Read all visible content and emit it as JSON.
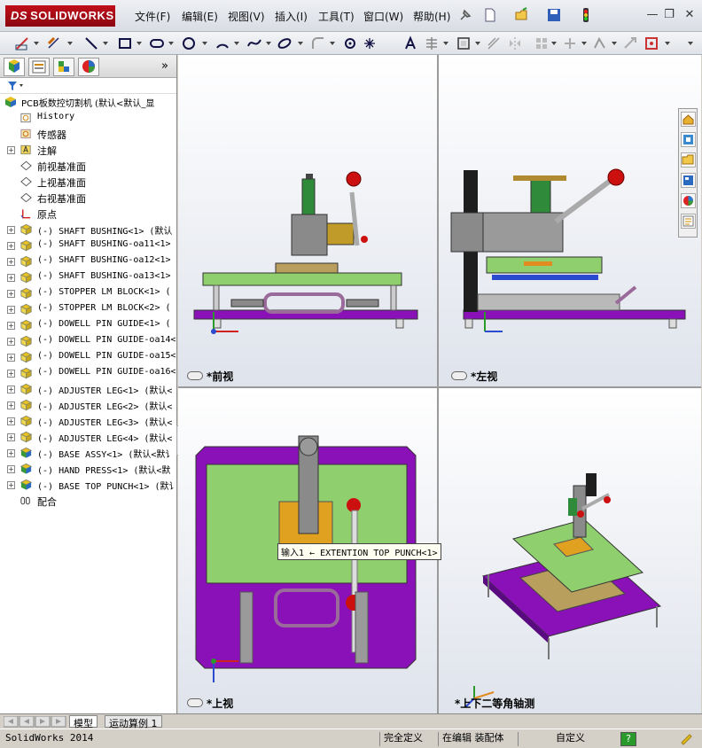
{
  "app": {
    "brand_prefix": "DS",
    "brand": "SOLIDWORKS"
  },
  "menu": [
    {
      "id": "file",
      "label": "文件(F)"
    },
    {
      "id": "edit",
      "label": "编辑(E)"
    },
    {
      "id": "view",
      "label": "视图(V)"
    },
    {
      "id": "insert",
      "label": "插入(I)"
    },
    {
      "id": "tools",
      "label": "工具(T)"
    },
    {
      "id": "window",
      "label": "窗口(W)"
    },
    {
      "id": "help",
      "label": "帮助(H)"
    }
  ],
  "window_buttons": {
    "minimize": "—",
    "restore": "❐",
    "close": "✕"
  },
  "feature_tree": {
    "expand_arrow": "»",
    "root": "PCB板数控切割机  (默认<默认_显",
    "items": [
      {
        "label": "History",
        "icon": "history-icon",
        "exp": false
      },
      {
        "label": "传感器",
        "icon": "sensor-icon",
        "exp": false
      },
      {
        "label": "注解",
        "icon": "annotation-icon",
        "exp": true
      },
      {
        "label": "前视基准面",
        "icon": "plane-icon",
        "exp": false
      },
      {
        "label": "上视基准面",
        "icon": "plane-icon",
        "exp": false
      },
      {
        "label": "右视基准面",
        "icon": "plane-icon",
        "exp": false
      },
      {
        "label": "原点",
        "icon": "origin-icon",
        "exp": false
      },
      {
        "label": "(-) SHAFT BUSHING<1> (默认",
        "icon": "part-icon",
        "exp": true
      },
      {
        "label": "(-) SHAFT BUSHING-oa11<1>",
        "icon": "part-icon",
        "exp": true
      },
      {
        "label": "(-) SHAFT BUSHING-oa12<1>",
        "icon": "part-icon",
        "exp": true
      },
      {
        "label": "(-) SHAFT BUSHING-oa13<1>",
        "icon": "part-icon",
        "exp": true
      },
      {
        "label": "(-) STOPPER LM BLOCK<1> (",
        "icon": "part-icon",
        "exp": true
      },
      {
        "label": "(-) STOPPER LM BLOCK<2> (",
        "icon": "part-icon",
        "exp": true
      },
      {
        "label": "(-) DOWELL PIN GUIDE<1> (",
        "icon": "part-icon",
        "exp": true
      },
      {
        "label": "(-) DOWELL PIN GUIDE-oa14<",
        "icon": "part-icon",
        "exp": true
      },
      {
        "label": "(-) DOWELL PIN GUIDE-oa15<",
        "icon": "part-icon",
        "exp": true
      },
      {
        "label": "(-) DOWELL PIN GUIDE-oa16<",
        "icon": "part-icon",
        "exp": true
      },
      {
        "label": "(-) ADJUSTER LEG<1> (默认<",
        "icon": "part-icon",
        "exp": true
      },
      {
        "label": "(-) ADJUSTER LEG<2> (默认<",
        "icon": "part-icon",
        "exp": true
      },
      {
        "label": "(-) ADJUSTER LEG<3> (默认<",
        "icon": "part-icon",
        "exp": true
      },
      {
        "label": "(-) ADJUSTER LEG<4> (默认<",
        "icon": "part-icon",
        "exp": true
      },
      {
        "label": "(-) BASE ASSY<1> (默认<默讠",
        "icon": "assembly-icon",
        "exp": true
      },
      {
        "label": "(-) HAND PRESS<1> (默认<默",
        "icon": "assembly-icon",
        "exp": true
      },
      {
        "label": "(-) BASE TOP PUNCH<1> (默讠",
        "icon": "assembly-icon",
        "exp": true
      },
      {
        "label": "配合",
        "icon": "mates-icon",
        "exp": false
      }
    ]
  },
  "viewports": {
    "front": {
      "label": "*前视"
    },
    "left": {
      "label": "*左视"
    },
    "top": {
      "label": "*上视"
    },
    "iso": {
      "label": "*上下二等角轴测"
    }
  },
  "tooltip": "输入1 ← EXTENTION TOP PUNCH<1>",
  "bottom_tabs": {
    "model": "模型",
    "motion": "运动算例 1"
  },
  "status": {
    "app": "SolidWorks 2014",
    "definition": "完全定义",
    "mode": "在编辑 装配体",
    "custom": "自定义",
    "help": "?"
  },
  "colors": {
    "brand": "#b30a14",
    "base": "#8a10b8",
    "plate": "#8fcf6e",
    "frame": "#9a9a9a"
  }
}
